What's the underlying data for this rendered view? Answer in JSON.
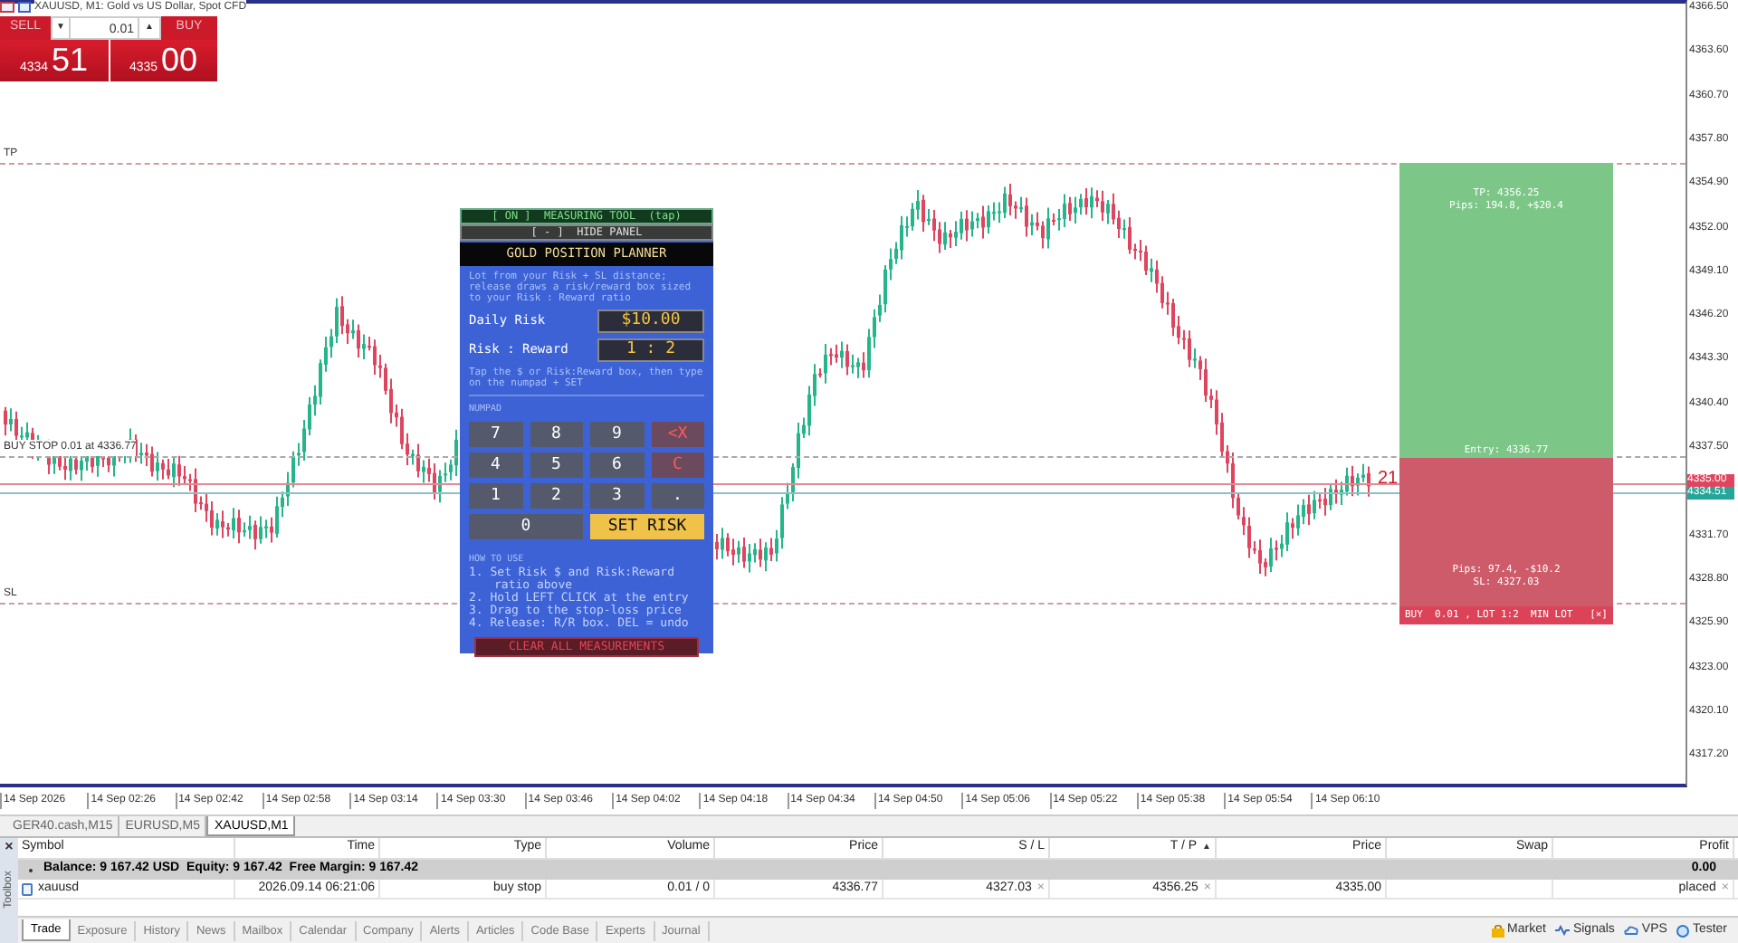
{
  "chart": {
    "title": "XAUUSD, M1:  Gold vs US Dollar, Spot CFD",
    "price_axis": [
      "4366.50",
      "4363.60",
      "4360.70",
      "4357.80",
      "4354.90",
      "4352.00",
      "4349.10",
      "4346.20",
      "4343.30",
      "4340.40",
      "4337.50",
      "4331.70",
      "4328.80",
      "4325.90",
      "4323.00",
      "4320.10",
      "4317.20"
    ],
    "time_axis": [
      "14 Sep 2026",
      "14 Sep 02:26",
      "14 Sep 02:42",
      "14 Sep 02:58",
      "14 Sep 03:14",
      "14 Sep 03:30",
      "14 Sep 03:46",
      "14 Sep 04:02",
      "14 Sep 04:18",
      "14 Sep 04:34",
      "14 Sep 04:50",
      "14 Sep 05:06",
      "14 Sep 05:22",
      "14 Sep 05:38",
      "14 Sep 05:54",
      "14 Sep 06:10"
    ],
    "tp_label": "TP",
    "order_label": "BUY STOP 0.01 at 4336.77",
    "sl_label": "SL",
    "ask_tag": "4335.00",
    "bid_tag": "4334.51",
    "countdown": "21"
  },
  "one_click": {
    "sell_label": "SELL",
    "buy_label": "BUY",
    "lot_down": "▼",
    "lot": "0.01",
    "lot_up": "▲",
    "sell_big": "4334",
    "sell_pips": "51",
    "buy_big": "4335",
    "buy_pips": "00"
  },
  "planner": {
    "toggle": "[ ON ]  MEASURING TOOL  (tap)",
    "hide": "[ - ]  HIDE PANEL",
    "title": "GOLD POSITION PLANNER",
    "intro": "Lot from your Risk + SL distance; release draws a risk/reward box sized to your Risk : Reward ratio",
    "fields": [
      {
        "label": "Daily Risk",
        "value": "$10.00"
      },
      {
        "label": "Risk : Reward",
        "value": "1 : 2"
      }
    ],
    "hint": "Tap the $ or Risk:Reward box, then type on the numpad + SET",
    "numpad_label": "NUMPAD",
    "keys": [
      {
        "label": "7",
        "kind": "digit"
      },
      {
        "label": "8",
        "kind": "digit"
      },
      {
        "label": "9",
        "kind": "digit"
      },
      {
        "label": "<X",
        "kind": "delete"
      },
      {
        "label": "4",
        "kind": "digit"
      },
      {
        "label": "5",
        "kind": "digit"
      },
      {
        "label": "6",
        "kind": "digit"
      },
      {
        "label": "C",
        "kind": "delete"
      },
      {
        "label": "1",
        "kind": "digit"
      },
      {
        "label": "2",
        "kind": "digit"
      },
      {
        "label": "3",
        "kind": "digit"
      },
      {
        "label": ".",
        "kind": "digit"
      },
      {
        "label": "0",
        "kind": "wide"
      },
      {
        "label": "SET RISK",
        "kind": "set"
      }
    ],
    "howto_title": "HOW TO USE",
    "steps": [
      "1. Set Risk $ and Risk:Reward",
      "ratio above",
      "2. Hold LEFT CLICK at the entry",
      "3. Drag to the stop-loss price",
      "4. Release: R/R box.  DEL = undo"
    ],
    "clear_button": "CLEAR ALL MEASUREMENTS"
  },
  "rr_box": {
    "tp_text": "TP: 4356.25",
    "tp_pips": "Pips: 194.8, +$20.4",
    "entry": "Entry: 4336.77",
    "sl_pips": "Pips: 97.4, -$10.2",
    "sl_text": "SL: 4327.03",
    "footer": "BUY  0.01 , LOT 1:2  MIN LOT",
    "close": "[×]"
  },
  "chart_tabs": [
    {
      "label": "GER40.cash,M15",
      "selected": false
    },
    {
      "label": "EURUSD,M5",
      "selected": false
    },
    {
      "label": "XAUUSD,M1",
      "selected": true
    }
  ],
  "toolbox": {
    "label": "Toolbox",
    "close": "×",
    "columns": [
      {
        "label": "Symbol"
      },
      {
        "label": "Time"
      },
      {
        "label": "Type"
      },
      {
        "label": "Volume"
      },
      {
        "label": "Price"
      },
      {
        "label": "S / L"
      },
      {
        "label": "T / P",
        "sort": "▲"
      },
      {
        "label": "Price"
      },
      {
        "label": "Swap"
      },
      {
        "label": "Profit"
      }
    ],
    "balance": {
      "text": "Balance: 9 167.42 USD  Equity: 9 167.42  Free Margin: 9 167.42",
      "profit": "0.00"
    },
    "rows": [
      {
        "cells": [
          {
            "text": "xauusd"
          },
          {
            "text": "2026.09.14 06:21:06"
          },
          {
            "text": "buy stop"
          },
          {
            "text": "0.01 / 0"
          },
          {
            "text": "4336.77"
          },
          {
            "text": "4327.03",
            "close": "×"
          },
          {
            "text": "4356.25",
            "close": "×"
          },
          {
            "text": "4335.00"
          },
          {},
          {
            "text": "placed",
            "close": "×"
          }
        ]
      }
    ],
    "tabs": [
      {
        "label": "Trade",
        "selected": true
      },
      {
        "label": "Exposure",
        "selected": false
      },
      {
        "label": "History",
        "selected": false
      },
      {
        "label": "News",
        "selected": false
      },
      {
        "label": "Mailbox",
        "selected": false
      },
      {
        "label": "Calendar",
        "selected": false
      },
      {
        "label": "Company",
        "selected": false
      },
      {
        "label": "Alerts",
        "selected": false
      },
      {
        "label": "Articles",
        "selected": false
      },
      {
        "label": "Code Base",
        "selected": false
      },
      {
        "label": "Experts",
        "selected": false
      },
      {
        "label": "Journal",
        "selected": false
      }
    ],
    "links": [
      {
        "label": "Market",
        "kind": "market"
      },
      {
        "label": "Signals",
        "kind": "signals"
      },
      {
        "label": "VPS",
        "kind": "vps"
      },
      {
        "label": "Tester",
        "kind": "tester"
      }
    ]
  }
}
